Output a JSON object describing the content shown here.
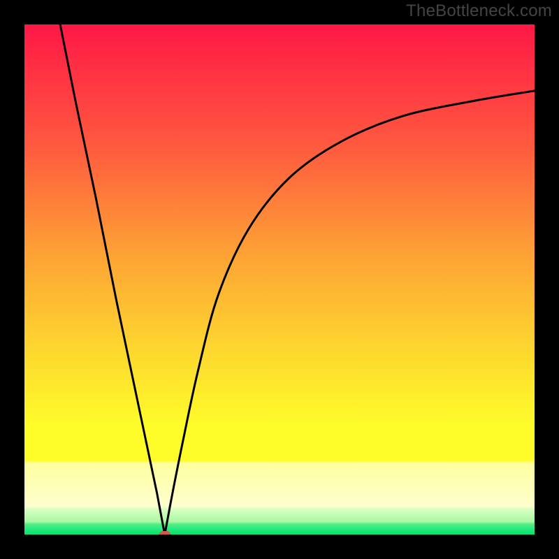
{
  "watermark": "TheBottleneck.com",
  "colors": {
    "top": "#fe1846",
    "upper_mid": "#fd7d3b",
    "mid": "#fdc732",
    "lower_mid": "#fefd2a",
    "pale_yellow": "#feff9e",
    "pale_green": "#c5ffb0",
    "green": "#00e36f",
    "curve": "#000000",
    "marker": "#d05a4a"
  },
  "chart_data": {
    "type": "line",
    "title": "",
    "xlabel": "",
    "ylabel": "",
    "xlim": [
      0,
      100
    ],
    "ylim": [
      0,
      100
    ],
    "legend": false,
    "grid": false,
    "series": [
      {
        "name": "left-branch",
        "x": [
          7,
          10,
          14,
          18,
          22,
          26,
          27.5
        ],
        "y": [
          100,
          85,
          66,
          46,
          27,
          8,
          0
        ]
      },
      {
        "name": "right-branch",
        "x": [
          27.5,
          29,
          31,
          34,
          38,
          44,
          52,
          62,
          74,
          88,
          100
        ],
        "y": [
          0,
          8,
          18,
          32,
          47,
          60,
          70,
          77,
          82,
          85,
          87
        ]
      }
    ],
    "annotations": [
      {
        "name": "min-marker",
        "x": 27.5,
        "y": 0
      }
    ]
  }
}
